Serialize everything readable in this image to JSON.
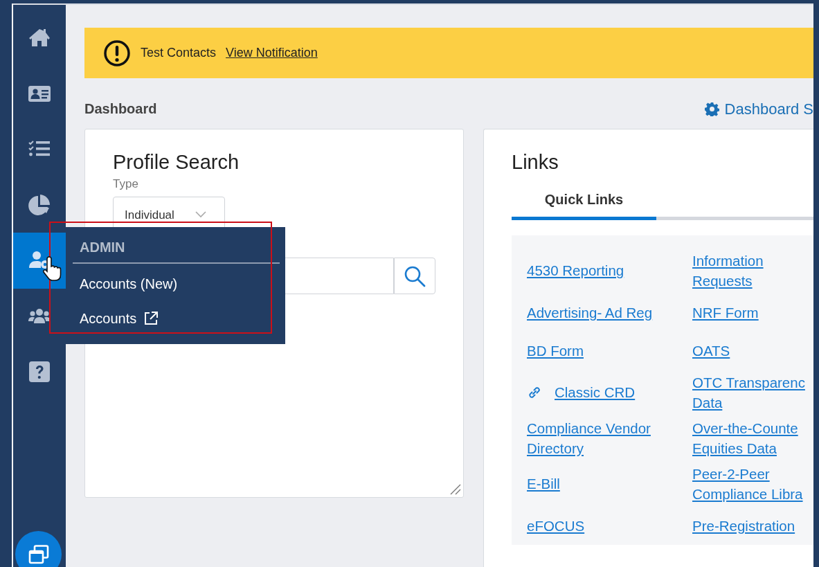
{
  "sidebar": {
    "items": [
      {
        "selected": false
      },
      {
        "selected": false
      },
      {
        "selected": false
      },
      {
        "selected": false
      },
      {
        "selected": true
      },
      {
        "selected": false
      },
      {
        "selected": false
      }
    ]
  },
  "admin_menu": {
    "heading": "ADMIN",
    "items": [
      {
        "label": "Accounts (New)",
        "external": false
      },
      {
        "label": "Accounts",
        "external": true
      }
    ]
  },
  "notification": {
    "text": "Test Contacts",
    "link": "View Notification"
  },
  "page_title": "Dashboard",
  "settings_link": "Dashboard S",
  "profile_search": {
    "title": "Profile Search",
    "type_label": "Type",
    "type_value": "Individual"
  },
  "links": {
    "title": "Links",
    "tabs": [
      {
        "label": "Quick Links",
        "selected": true
      }
    ],
    "rows": [
      [
        {
          "label": "4530 Reporting",
          "link_icon": false
        },
        {
          "label": "Information Requests",
          "link_icon": false
        }
      ],
      [
        {
          "label": "Advertising- Ad Reg",
          "link_icon": false
        },
        {
          "label": "NRF Form",
          "link_icon": false
        }
      ],
      [
        {
          "label": "BD Form",
          "link_icon": false
        },
        {
          "label": "OATS",
          "link_icon": false
        }
      ],
      [
        {
          "label": "Classic CRD",
          "link_icon": true
        },
        {
          "label": "OTC Transparenc Data",
          "link_icon": false
        }
      ],
      [
        {
          "label": "Compliance Vendor Directory",
          "link_icon": false
        },
        {
          "label": "Over-the-Counte Equities Data",
          "link_icon": false
        }
      ],
      [
        {
          "label": "E-Bill",
          "link_icon": false
        },
        {
          "label": "Peer-2-Peer Compliance Libra",
          "link_icon": false
        }
      ],
      [
        {
          "label": "eFOCUS",
          "link_icon": false
        },
        {
          "label": "Pre-Registration",
          "link_icon": false
        }
      ]
    ]
  }
}
